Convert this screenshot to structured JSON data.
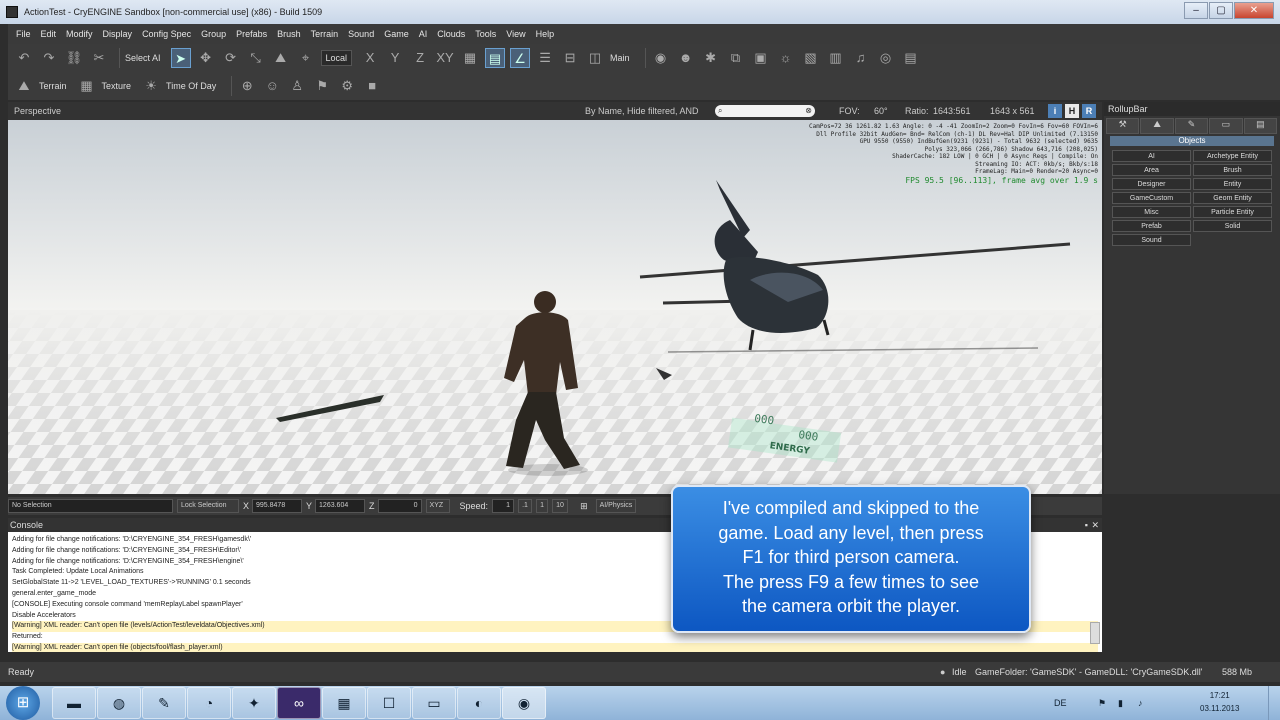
{
  "window": {
    "title": "ActionTest - CryENGINE Sandbox [non-commercial use] (x86) - Build 1509",
    "buttons": [
      "–",
      "▢",
      "✕"
    ]
  },
  "menu": [
    "File",
    "Edit",
    "Modify",
    "Display",
    "Config Spec",
    "Group",
    "Prefabs",
    "Brush",
    "Terrain",
    "Sound",
    "Game",
    "AI",
    "Clouds",
    "Tools",
    "View",
    "Help"
  ],
  "toolbar": {
    "select_ai": "Select AI",
    "coord_space": "Local",
    "axes": [
      "X",
      "Y",
      "Z",
      "XY"
    ],
    "layer": "Main",
    "terrain": "Terrain",
    "texture": "Texture",
    "time_of_day": "Time Of Day"
  },
  "viewport": {
    "label": "Perspective",
    "filter": "By Name, Hide filtered, AND",
    "search_value": "",
    "fov_label": "FOV:",
    "fov": "60°",
    "ratio_label": "Ratio:",
    "ratio": "1643:561",
    "size": "1643 x 561",
    "btn_i": "i",
    "btn_h": "H",
    "btn_r": "R"
  },
  "hud": {
    "lines": [
      "CamPos=72 36 1261.82 1.63 Angle: 0 -4 -41 ZoomIn=2 Zoom=0 FovIn=6 Fov=60 FOVIn=6",
      "Dll Profile 32bit AudGen= Bnd= RelCom (ch-1) DL Rev=Hal DIP Unlimited (7.13150",
      "GPU 9550 (9550) IndBufGen(9231 (9231) - Total 9632 (selected) 9635",
      "Polys 323,066 (266,786) Shadow 643,716 (208,025)",
      "ShaderCache: 182 LOW | 0 GCH | 0 Async Reqs | Compile: On",
      "Streaming IO: ACT: 0kb/s; Bkb/s:18",
      "FrameLag: Main=0 Render=20 Async=0"
    ],
    "fps": "FPS 95.5 [96..113], frame avg over 1.9 s",
    "fuel": "000",
    "ammo": "000",
    "energy": "ENERGY"
  },
  "rollup": {
    "title": "RollupBar",
    "objects_header": "Objects",
    "items": [
      "AI",
      "Archetype Entity",
      "Area",
      "Brush",
      "Designer",
      "Entity",
      "GameCustom",
      "Geom Entity",
      "Misc",
      "Particle Entity",
      "Prefab",
      "Solid",
      "Sound"
    ]
  },
  "status": {
    "selection": "No Selection",
    "lock_selection": "Lock Selection",
    "x_label": "X",
    "x": "995.8478",
    "y_label": "Y",
    "y": "1263.604",
    "z_label": "Z",
    "z": "0",
    "xyz": "XYZ",
    "speed_label": "Speed:",
    "speed": "1",
    "speed_opts": [
      ".1",
      "1",
      "10"
    ],
    "physics": "AI/Physics"
  },
  "console": {
    "title": "Console",
    "lines": [
      {
        "t": "Adding for file change notifications: 'D:\\CRYENGINE_354_FRESH\\gamesdk\\'",
        "w": false
      },
      {
        "t": "Adding for file change notifications: 'D:\\CRYENGINE_354_FRESH\\Editor\\'",
        "w": false
      },
      {
        "t": "Adding for file change notifications: 'D:\\CRYENGINE_354_FRESH\\engine\\'",
        "w": false
      },
      {
        "t": "Task Completed: Update Local Animations",
        "w": false
      },
      {
        "t": "SetGlobalState 11->2 'LEVEL_LOAD_TEXTURES'->'RUNNING' 0.1 seconds",
        "w": false
      },
      {
        "t": "general.enter_game_mode",
        "w": false
      },
      {
        "t": "[CONSOLE] Executing console command 'memReplayLabel spawnPlayer'",
        "w": false
      },
      {
        "t": "Disable Accelerators",
        "w": false
      },
      {
        "t": "[Warning] XML reader: Can't open file (levels/ActionTest/leveldata/Objectives.xml)",
        "w": true
      },
      {
        "t": "Returned:",
        "w": false
      },
      {
        "t": "[Warning] XML reader: Can't open file (objects/fool/flash_player.xml)",
        "w": true
      }
    ]
  },
  "statusbar": {
    "ready": "Ready",
    "idle": "Idle",
    "game_folder": "GameFolder: 'GameSDK' - GameDLL: 'CryGameSDK.dll'",
    "memory": "588 Mb"
  },
  "tooltip": {
    "line1": "I've compiled and skipped to the",
    "line2": "game. Load any level, then press",
    "line3": "F1 for third person camera.",
    "line4": "The press F9 a few times to see",
    "line5": "the camera orbit the player."
  },
  "taskbar": {
    "lang": "DE",
    "time": "17:21",
    "date": "03.11.2013"
  }
}
